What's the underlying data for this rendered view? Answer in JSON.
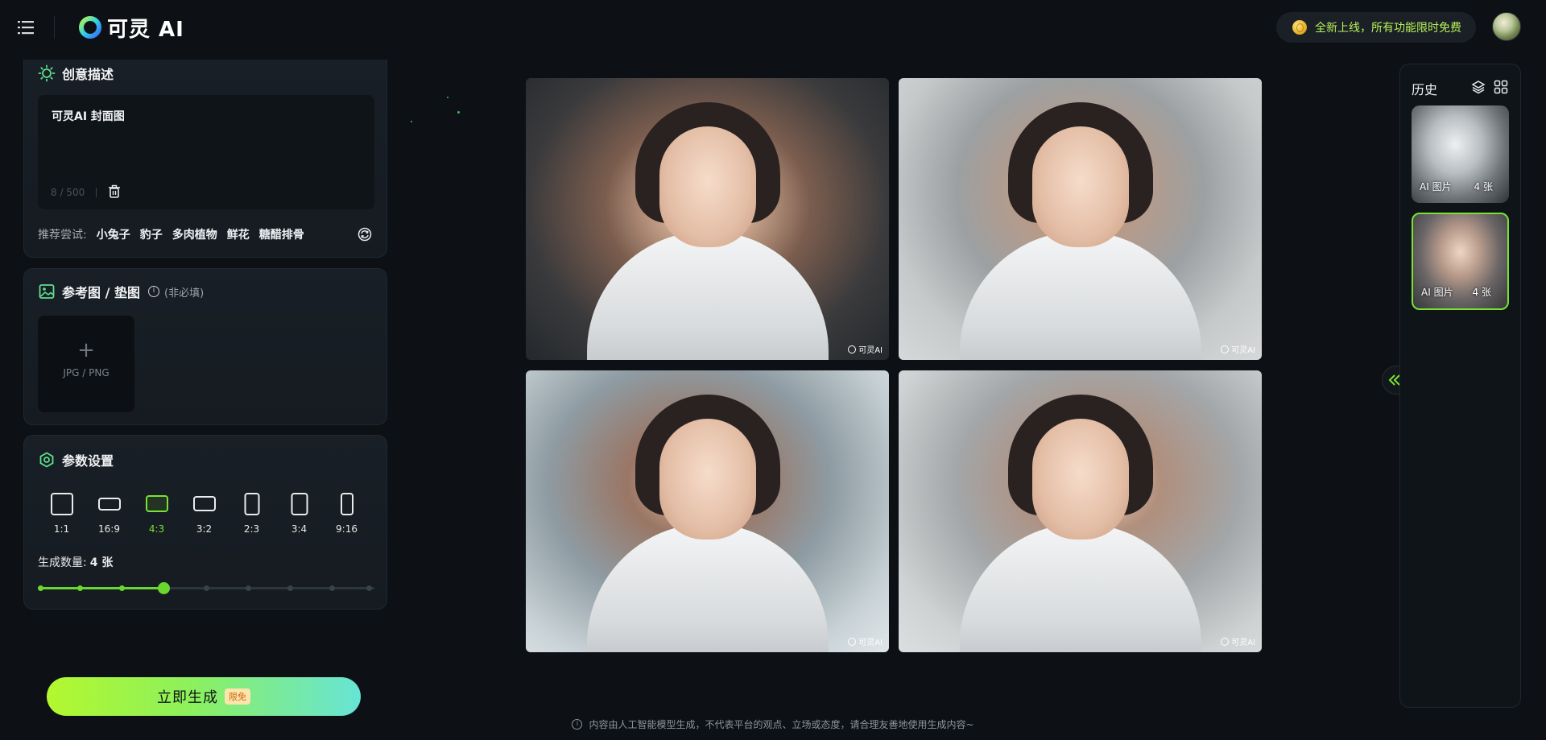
{
  "header": {
    "app_name": "可灵 AI",
    "promo_text": "全新上线，所有功能限时免费",
    "icons": {
      "menu": "menu-icon",
      "coin": "coin-icon",
      "avatar": "user-avatar"
    }
  },
  "prompt_section": {
    "title": "创意描述",
    "prompt_value": "可灵AI 封面图",
    "char_count": "8 / 500",
    "suggest_label": "推荐尝试:",
    "suggestions": [
      "小兔子",
      "豹子",
      "多肉植物",
      "鲜花",
      "糖醋排骨"
    ]
  },
  "reference_section": {
    "title": "参考图 / 垫图",
    "optional": "(非必填)",
    "upload_hint": "JPG / PNG"
  },
  "params_section": {
    "title": "参数设置",
    "ratios": [
      "1:1",
      "16:9",
      "4:3",
      "3:2",
      "2:3",
      "3:4",
      "9:16"
    ],
    "selected_ratio": "4:3",
    "count_label": "生成数量:",
    "count_value": "4 张",
    "count_selected": 4,
    "count_max": 9
  },
  "generate": {
    "label": "立即生成",
    "badge": "限免"
  },
  "gallery": {
    "watermark": "可灵AI",
    "image_count": 4
  },
  "history": {
    "title": "历史",
    "items": [
      {
        "label": "AI 图片",
        "count": "4 张"
      },
      {
        "label": "AI 图片",
        "count": "4 张"
      }
    ]
  },
  "footer": {
    "note": "内容由人工智能模型生成，不代表平台的观点、立场或态度，请合理友善地使用生成内容~"
  },
  "colors": {
    "accent": "#7be234",
    "background": "#0d1116",
    "promo_text": "#b8f05a"
  }
}
